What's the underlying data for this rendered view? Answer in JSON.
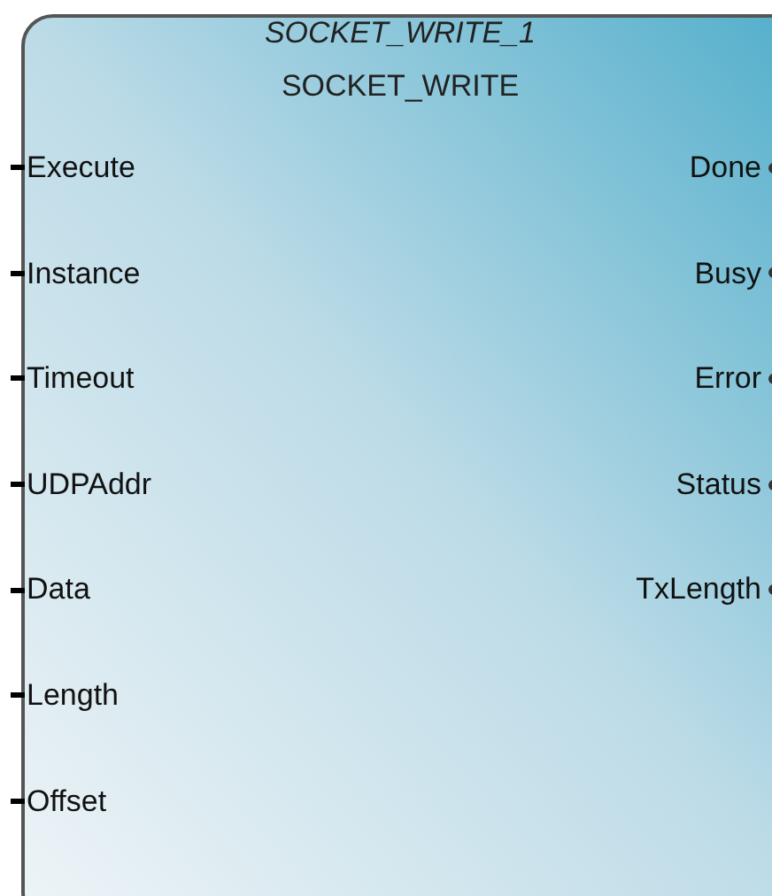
{
  "block": {
    "instance_name": "SOCKET_WRITE_1",
    "type_name": "SOCKET_WRITE",
    "inputs": [
      "Execute",
      "Instance",
      "Timeout",
      "UDPAddr",
      "Data",
      "Length",
      "Offset"
    ],
    "outputs": [
      "Done",
      "Busy",
      "Error",
      "Status",
      "TxLength"
    ]
  }
}
